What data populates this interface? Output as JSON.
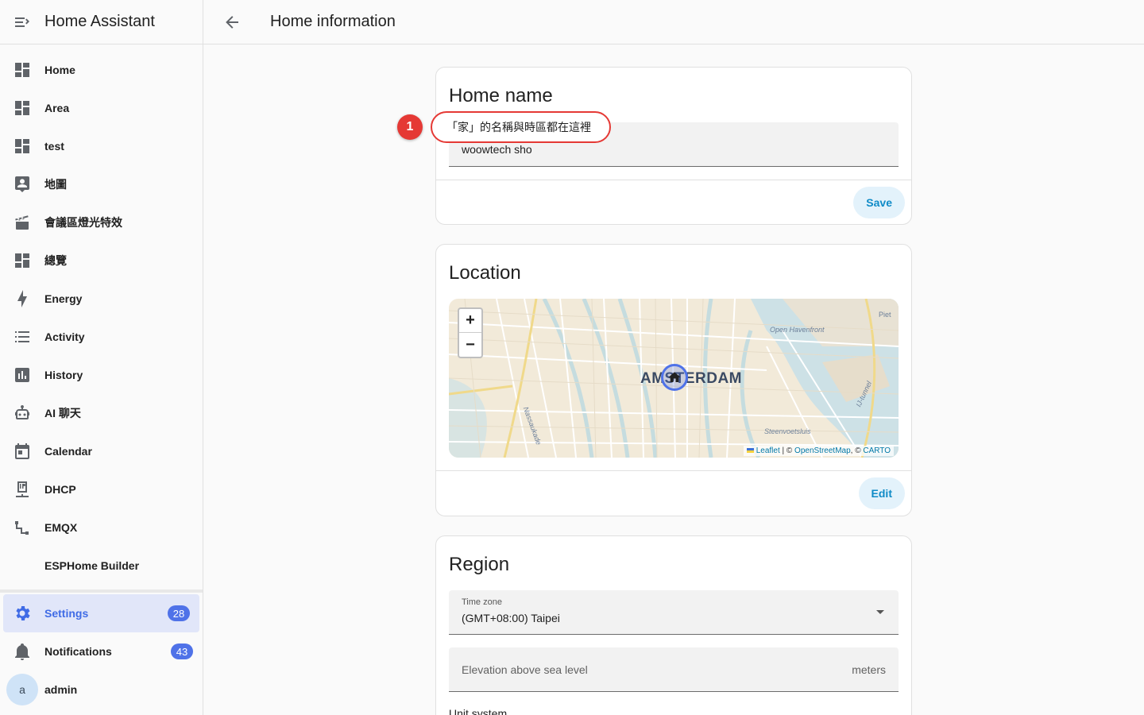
{
  "sidebar": {
    "title": "Home Assistant",
    "items": [
      {
        "label": "Home",
        "icon": "dashboard-icon"
      },
      {
        "label": "Area",
        "icon": "dashboard-icon"
      },
      {
        "label": "test",
        "icon": "dashboard-icon"
      },
      {
        "label": "地圖",
        "icon": "map-account-icon"
      },
      {
        "label": "會議區燈光特效",
        "icon": "clapperboard-icon"
      },
      {
        "label": "總覽",
        "icon": "dashboard-icon"
      },
      {
        "label": "Energy",
        "icon": "lightning-icon"
      },
      {
        "label": "Activity",
        "icon": "list-icon"
      },
      {
        "label": "History",
        "icon": "chart-box-icon"
      },
      {
        "label": "AI 聊天",
        "icon": "robot-icon"
      },
      {
        "label": "Calendar",
        "icon": "calendar-icon"
      },
      {
        "label": "DHCP",
        "icon": "ip-network-icon"
      },
      {
        "label": "EMQX",
        "icon": "ray-start-end-icon"
      },
      {
        "label": "ESPHome Builder",
        "icon": ""
      }
    ],
    "settings": {
      "label": "Settings",
      "badge": "28"
    },
    "notifications": {
      "label": "Notifications",
      "badge": "43"
    },
    "user": {
      "label": "admin",
      "avatar": "a"
    }
  },
  "topbar": {
    "title": "Home information"
  },
  "home_name_card": {
    "title": "Home name",
    "value": "woowtech sho",
    "save_label": "Save"
  },
  "callout": {
    "number": "1",
    "text": "「家」的名稱與時區都在這裡"
  },
  "location_card": {
    "title": "Location",
    "city_label": "AMSTERDAM",
    "labels": {
      "havenfront": "Open Havenfront",
      "steenvoetsluis": "Steenvoetsluis",
      "nassaukade": "Nassaukade",
      "tunnel": "IJ-tunnel",
      "piet": "Piet"
    },
    "attribution": {
      "leaflet": "Leaflet",
      "sep1": " | © ",
      "osm": "OpenStreetMap",
      "sep2": ", © ",
      "carto": "CARTO"
    },
    "zoom_in": "+",
    "zoom_out": "−",
    "edit_label": "Edit"
  },
  "region_card": {
    "title": "Region",
    "timezone_label": "Time zone",
    "timezone_value": "(GMT+08:00) Taipei",
    "elevation_placeholder": "Elevation above sea level",
    "elevation_unit": "meters",
    "unit_system_label": "Unit system"
  },
  "colors": {
    "accent": "#3f6be6",
    "badge": "#4f72e8",
    "callout": "#e53935",
    "button_text": "#0f8bc7"
  }
}
